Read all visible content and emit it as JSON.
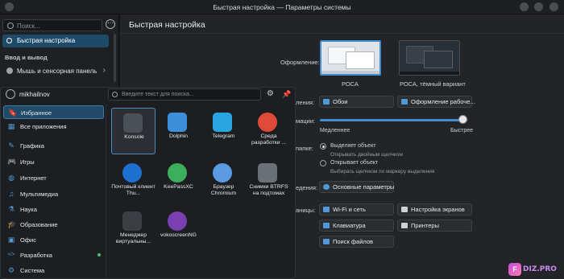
{
  "window": {
    "title": "Быстрая настройка — Параметры системы"
  },
  "settings": {
    "search_placeholder": "Поиск...",
    "sidebar": {
      "active_item": "Быстрая настройка",
      "section": "Ввод и вывод",
      "item": "Мышь и сенсорная панель"
    },
    "page_title": "Быстрая настройка",
    "appearance_label": "Оформление:",
    "themes": [
      "РОСА",
      "РОСА, тёмный вариант"
    ],
    "frag_wallpaper": "ления:",
    "wallpaper_btn": "Обои",
    "appearance_btn": "Оформление рабоче...",
    "frag_anim": "мации:",
    "slow": "Медленнее",
    "fast": "Быстрее",
    "animation_speed": 0.96,
    "frag_click": "папке:",
    "radio1": "Выделяет объект",
    "radio1_hint": "Открывать двойным щелчком",
    "radio2": "Открывает объект",
    "radio2_hint": "Выбирать щелчком по маркеру выделения",
    "frag_more": "едения:",
    "main_params_btn": "Основные параметры",
    "frag_pages": "аницы:",
    "btn_wifi": "Wi-Fi и сеть",
    "btn_display": "Настройка экранов",
    "btn_keyboard": "Клавиатура",
    "btn_printers": "Принтеры",
    "btn_filesearch": "Поиск файлов"
  },
  "launcher": {
    "username": "mikhailnov",
    "search_placeholder": "Введите текст для поиска...",
    "categories": [
      {
        "label": "Избранное",
        "icon": "bookmark-icon",
        "color": "#4f9ad6"
      },
      {
        "label": "Все приложения",
        "icon": "grid-icon",
        "color": "#4f9ad6"
      },
      {
        "label": "Графика",
        "icon": "brush-icon",
        "color": "#4f9ad6"
      },
      {
        "label": "Игры",
        "icon": "gamepad-icon",
        "color": "#4f9ad6"
      },
      {
        "label": "Интернет",
        "icon": "globe-icon",
        "color": "#4f9ad6"
      },
      {
        "label": "Мультимедиа",
        "icon": "media-icon",
        "color": "#4f9ad6"
      },
      {
        "label": "Наука",
        "icon": "flask-icon",
        "color": "#4f9ad6"
      },
      {
        "label": "Образование",
        "icon": "education-icon",
        "color": "#4f9ad6"
      },
      {
        "label": "Офис",
        "icon": "office-icon",
        "color": "#4f9ad6"
      },
      {
        "label": "Разработка",
        "icon": "code-icon",
        "color": "#4f9ad6"
      },
      {
        "label": "Система",
        "icon": "gear-icon",
        "color": "#4f9ad6"
      }
    ],
    "apps": [
      {
        "label": "Konsole",
        "icon": "terminal-icon",
        "color": "#4b5056"
      },
      {
        "label": "Dolphin",
        "icon": "folder-icon",
        "color": "#3d8fd8"
      },
      {
        "label": "Telegram",
        "icon": "telegram-icon",
        "color": "#2aa5df"
      },
      {
        "label": "Среда разработки ...",
        "icon": "ide-icon",
        "color": "#e04a3a"
      },
      {
        "label": "Почтовый клиент Thu...",
        "icon": "thunderbird-icon",
        "color": "#1f6fd1"
      },
      {
        "label": "KeePassXC",
        "icon": "key-icon",
        "color": "#3cae5c"
      },
      {
        "label": "Браузер Chromium",
        "icon": "chromium-icon",
        "color": "#5a9be4"
      },
      {
        "label": "Снимки BTRFS на подтомах",
        "icon": "snapshot-icon",
        "color": "#6b7076"
      },
      {
        "label": "Менеджер виртуальны...",
        "icon": "virt-manager-icon",
        "color": "#3a3d41"
      },
      {
        "label": "vokoscreenNG",
        "icon": "vokoscreen-icon",
        "color": "#7a3fb0"
      }
    ]
  },
  "watermark": {
    "text": "DIZ.PRO",
    "badge": "F"
  }
}
